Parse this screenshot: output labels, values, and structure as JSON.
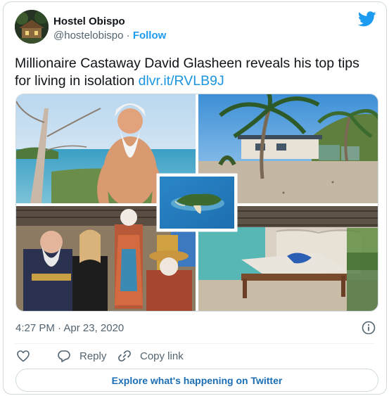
{
  "user": {
    "name": "Hostel Obispo",
    "handle": "@hostelobispo",
    "separator": "·",
    "follow_label": "Follow"
  },
  "tweet": {
    "text": "Millionaire Castaway David Glasheen reveals his top tips for living in isolation ",
    "link": "dlvr.it/RVLB9J"
  },
  "meta": {
    "timestamp": "4:27 PM · Apr 23, 2020"
  },
  "actions": {
    "reply_label": "Reply",
    "copy_link_label": "Copy link"
  },
  "explore_label": "Explore what's happening on Twitter",
  "colors": {
    "accent": "#1d9bf0",
    "link": "#1b95e0",
    "muted": "#536471",
    "border": "#cfd9de"
  },
  "icons": [
    "twitter-bird-icon",
    "info-icon",
    "heart-icon",
    "reply-icon",
    "link-icon"
  ]
}
